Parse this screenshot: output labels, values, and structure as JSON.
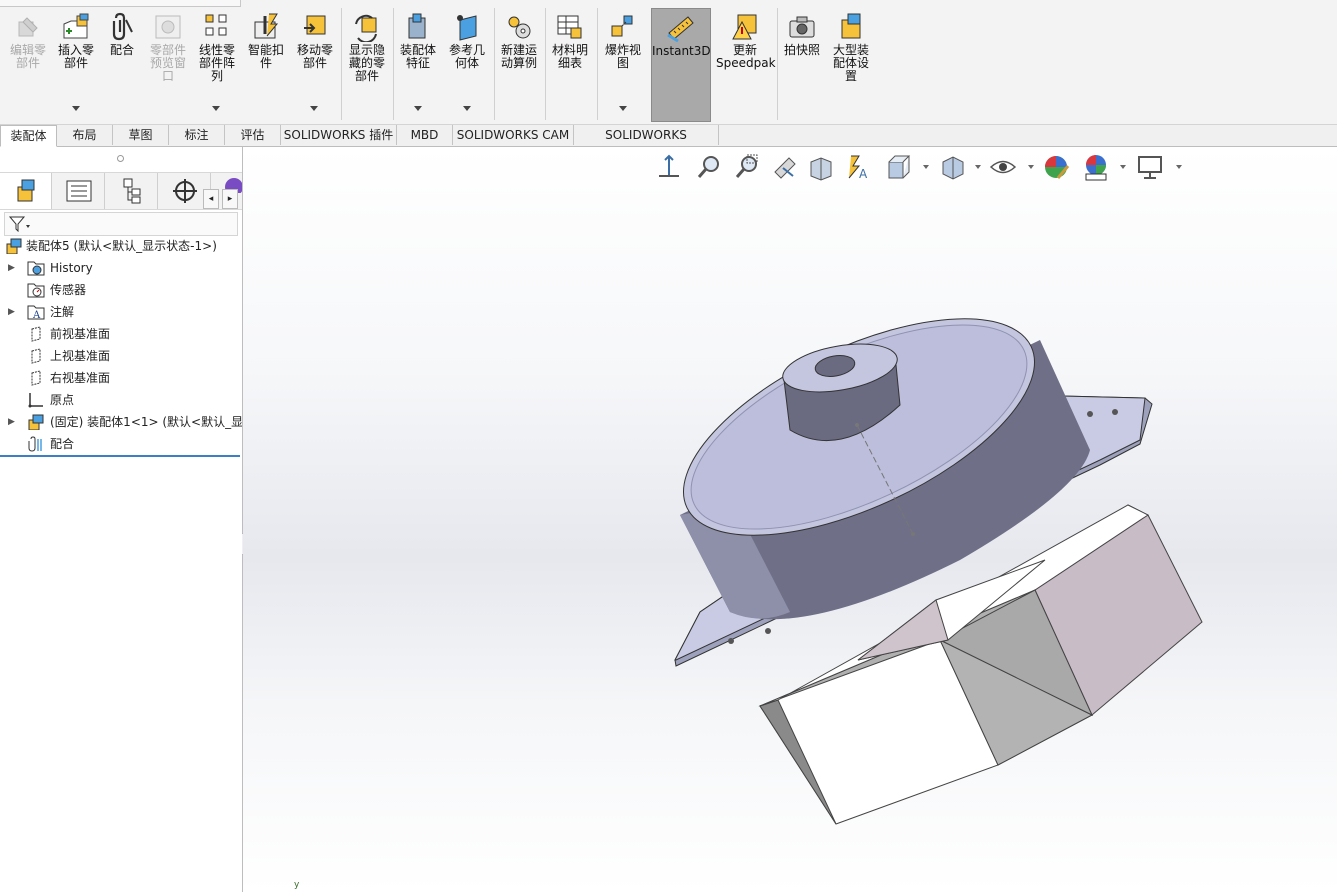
{
  "ribbon": {
    "buttons": [
      {
        "id": "edit-component",
        "label": "编辑零部件",
        "enabled": false
      },
      {
        "id": "insert-components",
        "label": "插入零部件",
        "enabled": true
      },
      {
        "id": "mate",
        "label": "配合",
        "enabled": true
      },
      {
        "id": "component-preview",
        "label": "零部件预览窗口",
        "enabled": false
      },
      {
        "id": "linear-pattern",
        "label": "线性零部件阵列",
        "enabled": true
      },
      {
        "id": "smart-fasteners",
        "label": "智能扣件",
        "enabled": true
      },
      {
        "id": "move-component",
        "label": "移动零部件",
        "enabled": true
      },
      {
        "id": "show-hidden",
        "label": "显示隐藏的零部件",
        "enabled": true
      },
      {
        "id": "assembly-features",
        "label": "装配体特征",
        "enabled": true
      },
      {
        "id": "reference-geometry",
        "label": "参考几何体",
        "enabled": true
      },
      {
        "id": "new-motion-study",
        "label": "新建运动算例",
        "enabled": true
      },
      {
        "id": "bill-of-materials",
        "label": "材料明细表",
        "enabled": true
      },
      {
        "id": "exploded-view",
        "label": "爆炸视图",
        "enabled": true
      },
      {
        "id": "instant3d",
        "label": "Instant3D",
        "enabled": true,
        "active": true
      },
      {
        "id": "update-speedpak",
        "label": "更新Speedpak",
        "enabled": true
      },
      {
        "id": "take-snapshot",
        "label": "拍快照",
        "enabled": true
      },
      {
        "id": "large-assembly",
        "label": "大型装配体设置",
        "enabled": true
      }
    ]
  },
  "tabs": [
    "装配体",
    "布局",
    "草图",
    "标注",
    "评估",
    "SOLIDWORKS 插件",
    "MBD",
    "SOLIDWORKS CAM",
    "SOLIDWORKS Inspection"
  ],
  "active_tab": "装配体",
  "feature_tree": {
    "root": "装配体5 (默认<默认_显示状态-1>)",
    "items": [
      {
        "label": "History",
        "expandable": true,
        "icon": "history-icon"
      },
      {
        "label": "传感器",
        "expandable": false,
        "icon": "sensor-icon"
      },
      {
        "label": "注解",
        "expandable": true,
        "icon": "annotation-icon"
      },
      {
        "label": "前视基准面",
        "expandable": false,
        "icon": "plane-icon"
      },
      {
        "label": "上视基准面",
        "expandable": false,
        "icon": "plane-icon"
      },
      {
        "label": "右视基准面",
        "expandable": false,
        "icon": "plane-icon"
      },
      {
        "label": "原点",
        "expandable": false,
        "icon": "origin-icon"
      },
      {
        "label": "(固定) 装配体1<1> (默认<默认_显示",
        "expandable": true,
        "icon": "subassembly-icon"
      },
      {
        "label": "配合",
        "expandable": false,
        "icon": "mates-icon"
      }
    ]
  },
  "viewport": {
    "axis_label": "y"
  },
  "colors": {
    "accent": "#3c7fc4",
    "instant3d_active": "#a9a9a9",
    "part_body": "#6f6f88",
    "part_top": "#c4c6e0",
    "block_white": "#ffffff",
    "block_side": "#c8bcc6"
  }
}
